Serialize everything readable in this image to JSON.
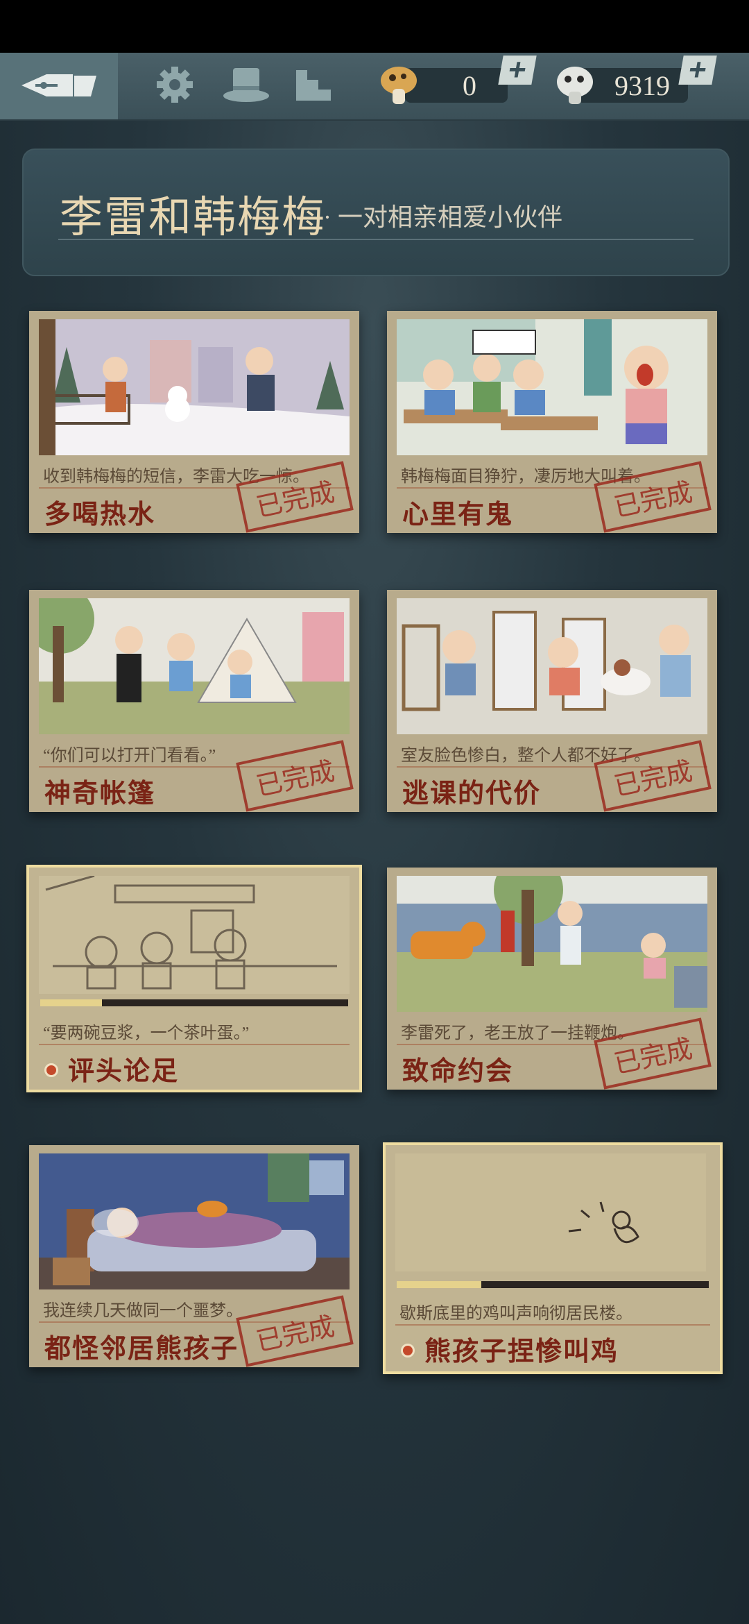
{
  "topbar": {
    "currency_mushroom": "0",
    "currency_token": "9319"
  },
  "header": {
    "title": "李雷和韩梅梅",
    "subtitle": "· 一对相亲相爱小伙伴"
  },
  "cards": [
    {
      "quote": "收到韩梅梅的短信，李雷大吃一惊。",
      "title": "多喝热水",
      "status": "已完成"
    },
    {
      "quote": "韩梅梅面目狰狞，凄厉地大叫着。",
      "title": "心里有鬼",
      "status": "已完成"
    },
    {
      "quote": "“你们可以打开门看看。”",
      "title": "神奇帐篷",
      "status": "已完成"
    },
    {
      "quote": "室友脸色惨白，整个人都不好了。",
      "title": "逃课的代价",
      "status": "已完成"
    },
    {
      "quote": "“要两碗豆浆，一个茶叶蛋。”",
      "title": "评头论足",
      "progress": 0.2
    },
    {
      "quote": "李雷死了，老王放了一挂鞭炮。",
      "title": "致命约会",
      "status": "已完成"
    },
    {
      "quote": "我连续几天做同一个噩梦。",
      "title": "都怪邻居熊孩子",
      "status": "已完成"
    },
    {
      "quote": "歇斯底里的鸡叫声响彻居民楼。",
      "title": "熊孩子捏惨叫鸡",
      "progress": 0.27
    }
  ],
  "icons": [
    "home-pen-icon",
    "settings-gear-icon",
    "hat-icon",
    "stairs-icon",
    "mushroom-icon",
    "token-icon",
    "plus-icon"
  ],
  "colors": {
    "accent": "#7a2315",
    "stamp": "#9b2a1e",
    "progress": "#e5d28c"
  }
}
